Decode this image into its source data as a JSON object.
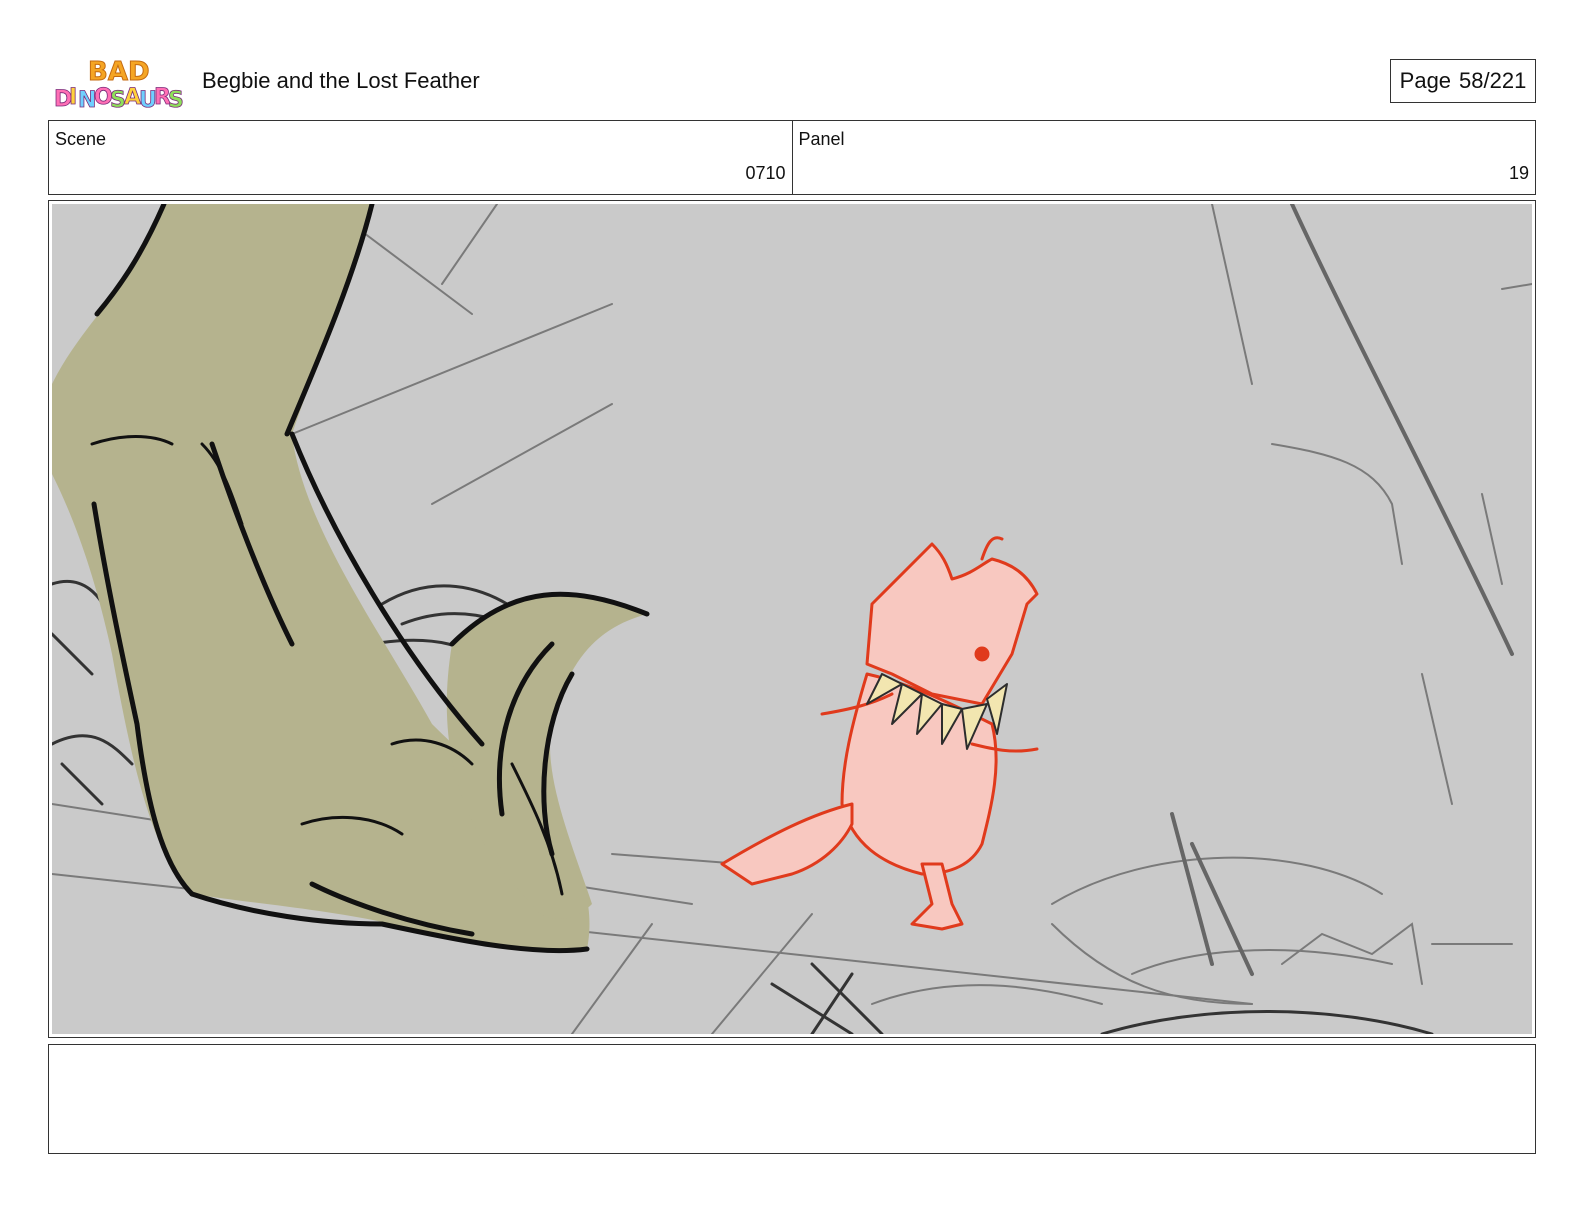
{
  "header": {
    "logo_text": "BAD DINOSAURS",
    "title": "Begbie and the Lost Feather",
    "page_label": "Page",
    "page_value": "58/221"
  },
  "info": {
    "scene_label": "Scene",
    "scene_value": "0710",
    "panel_label": "Panel",
    "panel_value": "19"
  },
  "panel": {
    "background_color": "#cacaca",
    "giant_leg_color": "#b5b38e",
    "small_dino_color": "#f8c8c0",
    "small_dino_outline": "#e03a1c",
    "teeth_color": "#f2e6b0"
  },
  "notes": {
    "text": ""
  }
}
